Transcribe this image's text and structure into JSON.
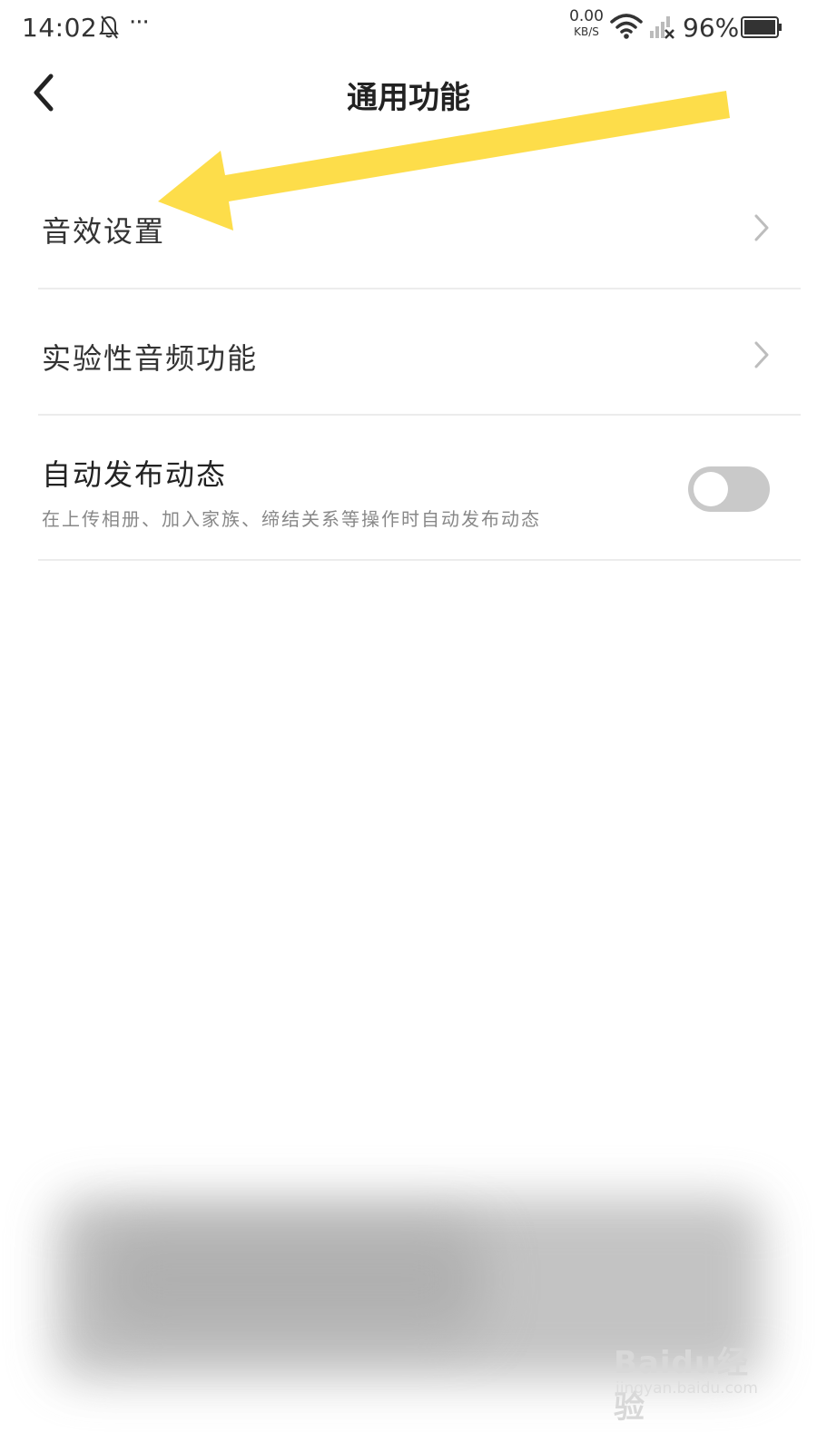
{
  "status_bar": {
    "time": "14:02",
    "more": "···",
    "net_speed_value": "0.00",
    "net_speed_unit": "KB/S",
    "battery": "96%"
  },
  "header": {
    "title": "通用功能"
  },
  "settings": {
    "items": [
      {
        "label": "音效设置"
      },
      {
        "label": "实验性音频功能"
      },
      {
        "label": "自动发布动态",
        "description": "在上传相册、加入家族、缔结关系等操作时自动发布动态",
        "toggle_on": false
      }
    ]
  },
  "colors": {
    "annotation_arrow": "#FDDD4A",
    "toggle_off": "#c9c9c9"
  },
  "watermark": {
    "logo": "Baidu经验",
    "url": "jingyan.baidu.com"
  }
}
